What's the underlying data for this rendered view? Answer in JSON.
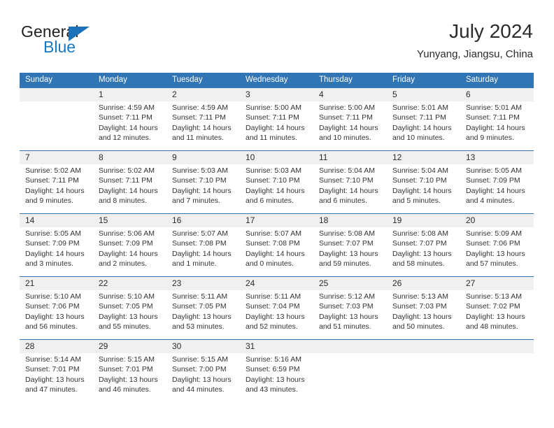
{
  "brand": {
    "name_top": "General",
    "name_bottom": "Blue",
    "accent_color": "#1b72b8"
  },
  "header": {
    "title": "July 2024",
    "subtitle": "Yunyang, Jiangsu, China",
    "header_bg_color": "#3175b5"
  },
  "weekdays": [
    "Sunday",
    "Monday",
    "Tuesday",
    "Wednesday",
    "Thursday",
    "Friday",
    "Saturday"
  ],
  "weeks": [
    {
      "days": [
        {
          "num": "",
          "lines": []
        },
        {
          "num": "1",
          "lines": [
            "Sunrise: 4:59 AM",
            "Sunset: 7:11 PM",
            "Daylight: 14 hours",
            "and 12 minutes."
          ]
        },
        {
          "num": "2",
          "lines": [
            "Sunrise: 4:59 AM",
            "Sunset: 7:11 PM",
            "Daylight: 14 hours",
            "and 11 minutes."
          ]
        },
        {
          "num": "3",
          "lines": [
            "Sunrise: 5:00 AM",
            "Sunset: 7:11 PM",
            "Daylight: 14 hours",
            "and 11 minutes."
          ]
        },
        {
          "num": "4",
          "lines": [
            "Sunrise: 5:00 AM",
            "Sunset: 7:11 PM",
            "Daylight: 14 hours",
            "and 10 minutes."
          ]
        },
        {
          "num": "5",
          "lines": [
            "Sunrise: 5:01 AM",
            "Sunset: 7:11 PM",
            "Daylight: 14 hours",
            "and 10 minutes."
          ]
        },
        {
          "num": "6",
          "lines": [
            "Sunrise: 5:01 AM",
            "Sunset: 7:11 PM",
            "Daylight: 14 hours",
            "and 9 minutes."
          ]
        }
      ]
    },
    {
      "days": [
        {
          "num": "7",
          "lines": [
            "Sunrise: 5:02 AM",
            "Sunset: 7:11 PM",
            "Daylight: 14 hours",
            "and 9 minutes."
          ]
        },
        {
          "num": "8",
          "lines": [
            "Sunrise: 5:02 AM",
            "Sunset: 7:11 PM",
            "Daylight: 14 hours",
            "and 8 minutes."
          ]
        },
        {
          "num": "9",
          "lines": [
            "Sunrise: 5:03 AM",
            "Sunset: 7:10 PM",
            "Daylight: 14 hours",
            "and 7 minutes."
          ]
        },
        {
          "num": "10",
          "lines": [
            "Sunrise: 5:03 AM",
            "Sunset: 7:10 PM",
            "Daylight: 14 hours",
            "and 6 minutes."
          ]
        },
        {
          "num": "11",
          "lines": [
            "Sunrise: 5:04 AM",
            "Sunset: 7:10 PM",
            "Daylight: 14 hours",
            "and 6 minutes."
          ]
        },
        {
          "num": "12",
          "lines": [
            "Sunrise: 5:04 AM",
            "Sunset: 7:10 PM",
            "Daylight: 14 hours",
            "and 5 minutes."
          ]
        },
        {
          "num": "13",
          "lines": [
            "Sunrise: 5:05 AM",
            "Sunset: 7:09 PM",
            "Daylight: 14 hours",
            "and 4 minutes."
          ]
        }
      ]
    },
    {
      "days": [
        {
          "num": "14",
          "lines": [
            "Sunrise: 5:05 AM",
            "Sunset: 7:09 PM",
            "Daylight: 14 hours",
            "and 3 minutes."
          ]
        },
        {
          "num": "15",
          "lines": [
            "Sunrise: 5:06 AM",
            "Sunset: 7:09 PM",
            "Daylight: 14 hours",
            "and 2 minutes."
          ]
        },
        {
          "num": "16",
          "lines": [
            "Sunrise: 5:07 AM",
            "Sunset: 7:08 PM",
            "Daylight: 14 hours",
            "and 1 minute."
          ]
        },
        {
          "num": "17",
          "lines": [
            "Sunrise: 5:07 AM",
            "Sunset: 7:08 PM",
            "Daylight: 14 hours",
            "and 0 minutes."
          ]
        },
        {
          "num": "18",
          "lines": [
            "Sunrise: 5:08 AM",
            "Sunset: 7:07 PM",
            "Daylight: 13 hours",
            "and 59 minutes."
          ]
        },
        {
          "num": "19",
          "lines": [
            "Sunrise: 5:08 AM",
            "Sunset: 7:07 PM",
            "Daylight: 13 hours",
            "and 58 minutes."
          ]
        },
        {
          "num": "20",
          "lines": [
            "Sunrise: 5:09 AM",
            "Sunset: 7:06 PM",
            "Daylight: 13 hours",
            "and 57 minutes."
          ]
        }
      ]
    },
    {
      "days": [
        {
          "num": "21",
          "lines": [
            "Sunrise: 5:10 AM",
            "Sunset: 7:06 PM",
            "Daylight: 13 hours",
            "and 56 minutes."
          ]
        },
        {
          "num": "22",
          "lines": [
            "Sunrise: 5:10 AM",
            "Sunset: 7:05 PM",
            "Daylight: 13 hours",
            "and 55 minutes."
          ]
        },
        {
          "num": "23",
          "lines": [
            "Sunrise: 5:11 AM",
            "Sunset: 7:05 PM",
            "Daylight: 13 hours",
            "and 53 minutes."
          ]
        },
        {
          "num": "24",
          "lines": [
            "Sunrise: 5:11 AM",
            "Sunset: 7:04 PM",
            "Daylight: 13 hours",
            "and 52 minutes."
          ]
        },
        {
          "num": "25",
          "lines": [
            "Sunrise: 5:12 AM",
            "Sunset: 7:03 PM",
            "Daylight: 13 hours",
            "and 51 minutes."
          ]
        },
        {
          "num": "26",
          "lines": [
            "Sunrise: 5:13 AM",
            "Sunset: 7:03 PM",
            "Daylight: 13 hours",
            "and 50 minutes."
          ]
        },
        {
          "num": "27",
          "lines": [
            "Sunrise: 5:13 AM",
            "Sunset: 7:02 PM",
            "Daylight: 13 hours",
            "and 48 minutes."
          ]
        }
      ]
    },
    {
      "days": [
        {
          "num": "28",
          "lines": [
            "Sunrise: 5:14 AM",
            "Sunset: 7:01 PM",
            "Daylight: 13 hours",
            "and 47 minutes."
          ]
        },
        {
          "num": "29",
          "lines": [
            "Sunrise: 5:15 AM",
            "Sunset: 7:01 PM",
            "Daylight: 13 hours",
            "and 46 minutes."
          ]
        },
        {
          "num": "30",
          "lines": [
            "Sunrise: 5:15 AM",
            "Sunset: 7:00 PM",
            "Daylight: 13 hours",
            "and 44 minutes."
          ]
        },
        {
          "num": "31",
          "lines": [
            "Sunrise: 5:16 AM",
            "Sunset: 6:59 PM",
            "Daylight: 13 hours",
            "and 43 minutes."
          ]
        },
        {
          "num": "",
          "lines": []
        },
        {
          "num": "",
          "lines": []
        },
        {
          "num": "",
          "lines": []
        }
      ]
    }
  ]
}
